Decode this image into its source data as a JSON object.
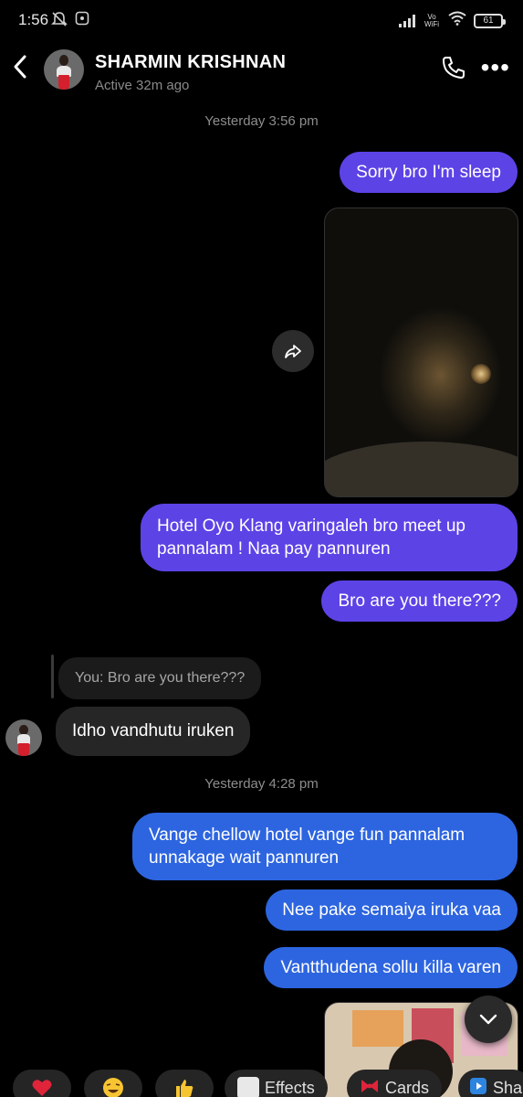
{
  "status_bar": {
    "time": "1:56",
    "network": "Vo WiFi",
    "battery": "61"
  },
  "header": {
    "contact_name": "SHARMIN KRISHNAN",
    "contact_status": "Active 32m ago"
  },
  "messages": {
    "ts1": "Yesterday 3:56 pm",
    "m1": "Sorry bro I'm sleep",
    "m2_line1": "Hotel Oyo Klang varingaleh bro meet up",
    "m2_line2": "pannalam ! Naa pay pannuren",
    "m3": "Bro are you there???",
    "reply_quote": "You: Bro are you there???",
    "incoming1": "Idho vandhutu iruken",
    "ts2": "Yesterday 4:28 pm",
    "m4_line1": "Vange chellow hotel vange fun pannalam",
    "m4_line2": "unnakage wait pannuren",
    "m5": "Nee pake semaiya iruka vaa",
    "m6": "Vantthudena sollu killa varen"
  },
  "quick_bar": {
    "effects": "Effects",
    "cards": "Cards",
    "share": "Sha"
  },
  "colors": {
    "bubble_purple": "#5c43e6",
    "bubble_blue": "#2d65e0",
    "incoming_grey": "#262626",
    "background": "#000000"
  },
  "icons": [
    "back-arrow-icon",
    "phone-icon",
    "more-icon",
    "share-icon",
    "chevron-down-icon",
    "heart-icon",
    "laughing-emoji-icon",
    "thumbs-up-icon"
  ]
}
